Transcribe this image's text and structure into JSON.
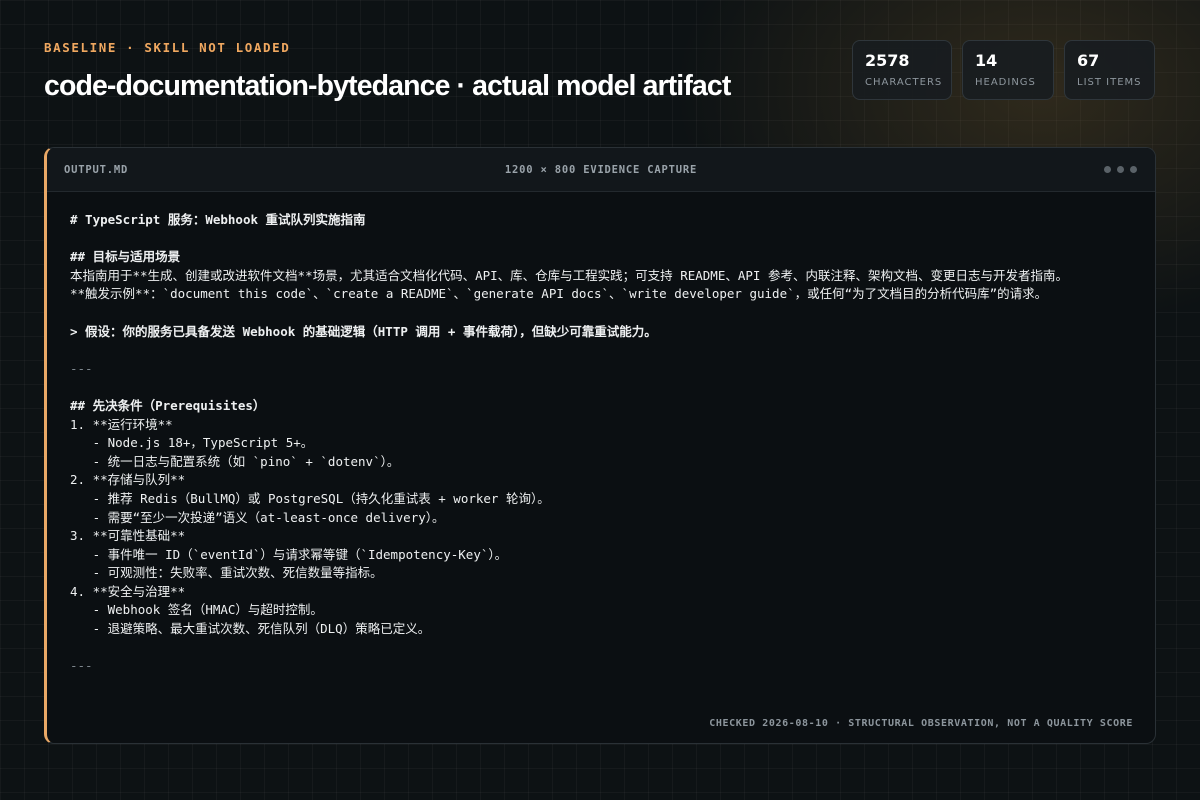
{
  "header": {
    "eyebrow": "BASELINE · SKILL NOT LOADED",
    "title": "code-documentation-bytedance · actual model artifact"
  },
  "stats": [
    {
      "value": "2578",
      "label": "CHARACTERS"
    },
    {
      "value": "14",
      "label": "HEADINGS"
    },
    {
      "value": "67",
      "label": "LIST ITEMS"
    }
  ],
  "panel": {
    "filename": "OUTPUT.MD",
    "caption": "1200 × 800 EVIDENCE CAPTURE",
    "footer": "CHECKED 2026-08-10 · STRUCTURAL OBSERVATION, NOT A QUALITY SCORE"
  },
  "document": {
    "lines": [
      "# TypeScript 服务：Webhook 重试队列实施指南",
      "",
      "## 目标与适用场景",
      "本指南用于**生成、创建或改进软件文档**场景，尤其适合文档化代码、API、库、仓库与工程实践；可支持 README、API 参考、内联注释、架构文档、变更日志与开发者指南。",
      "**触发示例**：`document this code`、`create a README`、`generate API docs`、`write developer guide`，或任何“为了文档目的分析代码库”的请求。",
      "",
      "> 假设：你的服务已具备发送 Webhook 的基础逻辑（HTTP 调用 + 事件载荷），但缺少可靠重试能力。",
      "",
      "---",
      "",
      "## 先决条件（Prerequisites）",
      "1. **运行环境**",
      "   - Node.js 18+，TypeScript 5+。",
      "   - 统一日志与配置系统（如 `pino` + `dotenv`）。",
      "2. **存储与队列**",
      "   - 推荐 Redis（BullMQ）或 PostgreSQL（持久化重试表 + worker 轮询）。",
      "   - 需要“至少一次投递”语义（at-least-once delivery）。",
      "3. **可靠性基础**",
      "   - 事件唯一 ID（`eventId`）与请求幂等键（`Idempotency-Key`）。",
      "   - 可观测性：失败率、重试次数、死信数量等指标。",
      "4. **安全与治理**",
      "   - Webhook 签名（HMAC）与超时控制。",
      "   - 退避策略、最大重试次数、死信队列（DLQ）策略已定义。",
      "",
      "---"
    ]
  }
}
